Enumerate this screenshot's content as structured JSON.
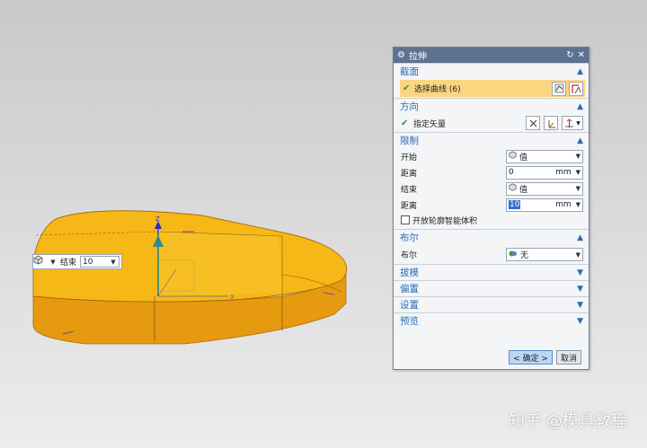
{
  "dialog": {
    "title": "拉伸",
    "sections": {
      "section_curve": "截面",
      "direction": "方向",
      "limits": "限制",
      "boolean": "布尔",
      "draft": "拔模",
      "offset": "偏置",
      "settings": "设置",
      "preview": "预览"
    },
    "select_curve_label": "选择曲线 (6)",
    "specify_vector_label": "指定矢量",
    "start_label": "开始",
    "start_value": "值",
    "distance1_label": "距离",
    "distance1_value": "0",
    "distance1_unit": "mm",
    "end_label": "结束",
    "end_value": "值",
    "distance2_label": "距离",
    "distance2_value": "10",
    "distance2_unit": "mm",
    "open_profile_label": "开放轮廓智能体积",
    "boolean_label": "布尔",
    "boolean_value": "无",
    "ok_button": "< 确定 >",
    "cancel_button": "取消"
  },
  "viewport": {
    "mini_label": "结束",
    "mini_value": "10",
    "axis_z": "Z",
    "axis_x": "X"
  },
  "watermark": "知乎 @模具教程",
  "colors": {
    "part_face": "#f6b817",
    "part_side": "#e59a10",
    "title_bar": "#5d7190",
    "section_text": "#2b6bb0",
    "selection_highlight": "#fbd680"
  }
}
